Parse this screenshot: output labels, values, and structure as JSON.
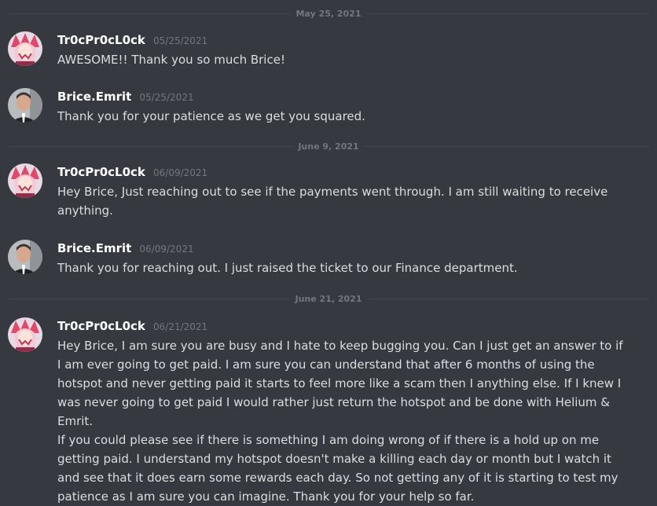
{
  "dividers": [
    "May 25, 2021",
    "June 9, 2021",
    "June 21, 2021"
  ],
  "messages": [
    {
      "author": "Tr0cPr0cL0ck",
      "timestamp": "05/25/2021",
      "lines": [
        "AWESOME!! Thank you so much Brice!"
      ],
      "avatar_icon": "anime-character-avatar-icon"
    },
    {
      "author": "Brice.Emrit",
      "timestamp": "05/25/2021",
      "lines": [
        "Thank you for your patience as we get you squared."
      ],
      "avatar_icon": "person-photo-avatar-icon"
    },
    {
      "author": "Tr0cPr0cL0ck",
      "timestamp": "06/09/2021",
      "lines": [
        "Hey Brice, Just reaching out to see if the payments went through. I am still waiting to receive anything."
      ],
      "avatar_icon": "anime-character-avatar-icon"
    },
    {
      "author": "Brice.Emrit",
      "timestamp": "06/09/2021",
      "lines": [
        "Thank you for reaching out. I just raised the ticket to our Finance department."
      ],
      "avatar_icon": "person-photo-avatar-icon"
    },
    {
      "author": "Tr0cPr0cL0ck",
      "timestamp": "06/21/2021",
      "lines": [
        "Hey Brice, I am sure you are busy and I hate to keep bugging you. Can I just get an answer to if I am ever going to get paid. I am sure you can understand that after 6 months of using the hotspot and never getting paid it starts to feel more like a scam then I anything else. If I knew I was never going to get paid I would rather just return the hotspot and be done with Helium & Emrit.",
        "If you could please see if there is something I am doing wrong of if there is a hold up on me getting paid. I understand my hotspot doesn't make a killing each day or month but I watch it and see that it does earn some rewards each day. So not getting any of it is starting to test my patience as I am sure you can imagine. Thank you for your help so far."
      ],
      "avatar_icon": "anime-character-avatar-icon"
    }
  ],
  "colors": {
    "background": "#36393f",
    "text": "#dcddde",
    "author": "#ffffff",
    "muted": "#72767d",
    "divider": "#42454a"
  }
}
